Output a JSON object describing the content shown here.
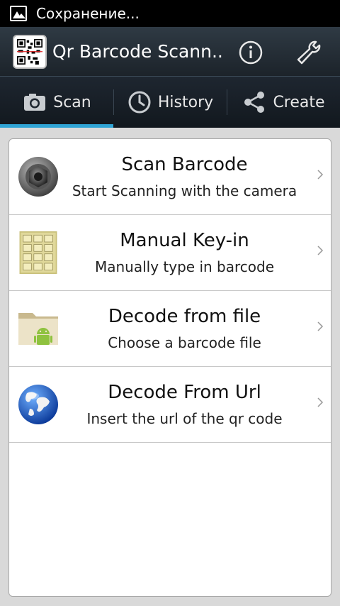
{
  "status_bar": {
    "text": "Сохранение..."
  },
  "action_bar": {
    "title": "Qr Barcode Scann..."
  },
  "tabs": [
    {
      "label": "Scan",
      "icon": "camera-icon",
      "active": true
    },
    {
      "label": "History",
      "icon": "clock-icon",
      "active": false
    },
    {
      "label": "Create",
      "icon": "share-icon",
      "active": false
    }
  ],
  "items": [
    {
      "title": "Scan Barcode",
      "subtitle": "Start Scanning with the camera",
      "icon": "camera-lens-icon"
    },
    {
      "title": "Manual Key-in",
      "subtitle": "Manually type in barcode",
      "icon": "keypad-icon"
    },
    {
      "title": "Decode from file",
      "subtitle": "Choose a barcode file",
      "icon": "folder-android-icon"
    },
    {
      "title": "Decode From Url",
      "subtitle": "Insert the url of the qr code",
      "icon": "globe-icon"
    }
  ],
  "colors": {
    "accent": "#2fa4d4",
    "actionbar": "#2f3a44",
    "tabbar": "#1e2630",
    "background": "#d9d9d9"
  }
}
